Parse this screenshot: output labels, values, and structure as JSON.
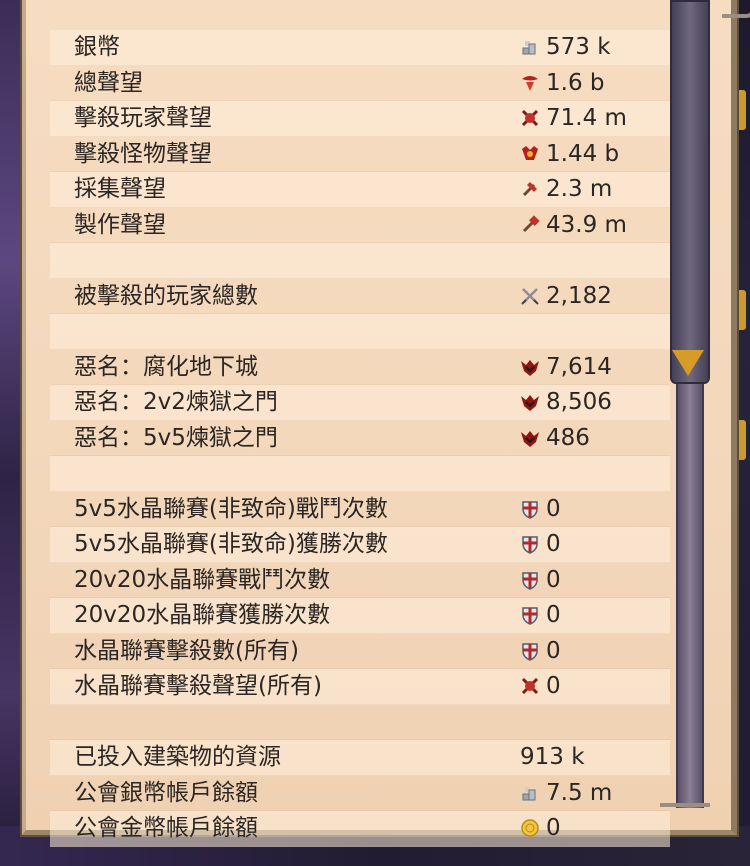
{
  "stats": [
    {
      "label": "銀幣",
      "icon": "silver-coin-icon",
      "value": "573 k"
    },
    {
      "label": "總聲望",
      "icon": "total-fame-icon",
      "value": "1.6 b"
    },
    {
      "label": "擊殺玩家聲望",
      "icon": "pvp-fame-icon",
      "value": "71.4 m"
    },
    {
      "label": "擊殺怪物聲望",
      "icon": "pve-fame-icon",
      "value": "1.44 b"
    },
    {
      "label": "採集聲望",
      "icon": "gathering-fame-icon",
      "value": "2.3 m"
    },
    {
      "label": "製作聲望",
      "icon": "crafting-fame-icon",
      "value": "43.9 m"
    },
    {
      "label": "",
      "icon": "",
      "value": ""
    },
    {
      "label": "被擊殺的玩家總數",
      "icon": "swords-icon",
      "value": "2,182"
    },
    {
      "label": "",
      "icon": "",
      "value": ""
    },
    {
      "label": "惡名：腐化地下城",
      "icon": "infamy-icon",
      "value": "7,614"
    },
    {
      "label": "惡名：2v2煉獄之門",
      "icon": "infamy-icon",
      "value": "8,506"
    },
    {
      "label": "惡名：5v5煉獄之門",
      "icon": "infamy-icon",
      "value": "486"
    },
    {
      "label": "",
      "icon": "",
      "value": ""
    },
    {
      "label": "5v5水晶聯賽(非致命)戰鬥次數",
      "icon": "shield-icon",
      "value": "0"
    },
    {
      "label": "5v5水晶聯賽(非致命)獲勝次數",
      "icon": "shield-icon",
      "value": "0"
    },
    {
      "label": "20v20水晶聯賽戰鬥次數",
      "icon": "shield-icon",
      "value": "0"
    },
    {
      "label": "20v20水晶聯賽獲勝次數",
      "icon": "shield-icon",
      "value": "0"
    },
    {
      "label": "水晶聯賽擊殺數(所有)",
      "icon": "shield-icon",
      "value": "0"
    },
    {
      "label": "水晶聯賽擊殺聲望(所有)",
      "icon": "pvp-fame-icon",
      "value": "0"
    },
    {
      "label": "",
      "icon": "",
      "value": ""
    },
    {
      "label": "已投入建築物的資源",
      "icon": "",
      "value": "913 k"
    },
    {
      "label": "公會銀幣帳戶餘額",
      "icon": "silver-coin-icon",
      "value": "7.5 m"
    },
    {
      "label": "公會金幣帳戶餘額",
      "icon": "gold-coin-icon",
      "value": "0"
    }
  ]
}
